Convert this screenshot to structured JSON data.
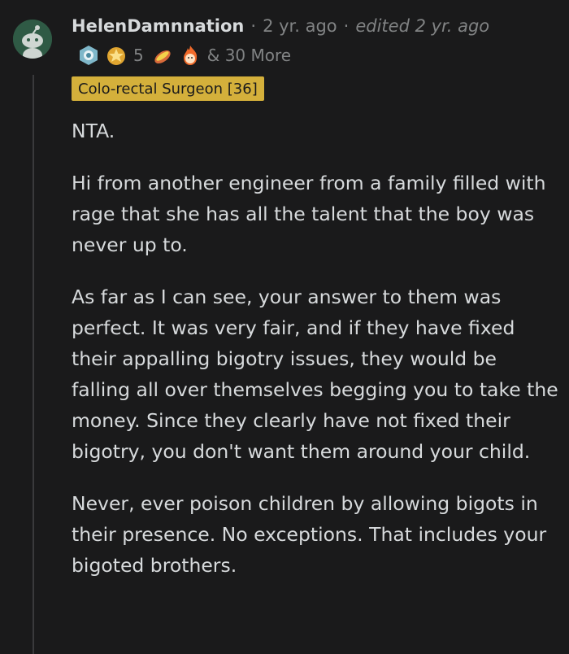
{
  "comment": {
    "username": "HelenDamnnation",
    "separator": "·",
    "time": "2 yr. ago",
    "edited": "edited 2 yr. ago",
    "awards": [
      {
        "icon": "hexagon-award-icon"
      },
      {
        "icon": "star-crown-award-icon",
        "count": "5"
      },
      {
        "icon": "mustard-hotdog-award-icon"
      },
      {
        "icon": "fire-face-award-icon"
      }
    ],
    "more_awards": "& 30 More",
    "flair": "Colo-rectal Surgeon [36]",
    "paragraphs": [
      "NTA.",
      "Hi from another engineer from a family filled with rage that she has all the talent that the boy was never up to.",
      "As far as I can see, your answer to them was perfect. It was very fair, and if they have fixed their appalling bigotry issues, they would be falling all over themselves begging you to take the money. Since they clearly have not fixed their bigotry, you don't want them around your child.",
      "Never, ever poison children by allowing bigots in their presence. No exceptions. That includes your bigoted brothers."
    ]
  },
  "colors": {
    "background": "#1a1a1b",
    "text": "#d7dadc",
    "muted": "#818384",
    "flair_bg": "#d4b03b",
    "thread_line": "#3a3a3c"
  }
}
